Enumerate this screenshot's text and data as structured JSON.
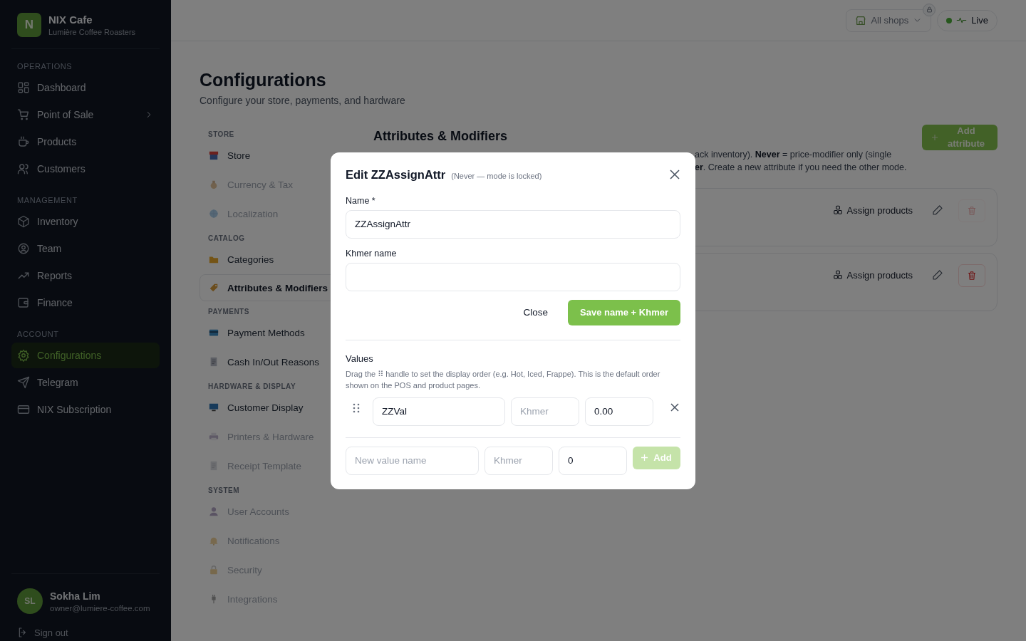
{
  "brand": {
    "initial": "N",
    "name": "NIX Cafe",
    "subtitle": "Lumière Coffee Roasters"
  },
  "sidebar": {
    "sections": [
      {
        "heading": "OPERATIONS",
        "items": [
          {
            "label": "Dashboard",
            "selected": false,
            "submenu": false
          },
          {
            "label": "Point of Sale",
            "selected": false,
            "submenu": true
          },
          {
            "label": "Products",
            "selected": false,
            "submenu": false
          },
          {
            "label": "Customers",
            "selected": false,
            "submenu": false
          }
        ]
      },
      {
        "heading": "MANAGEMENT",
        "items": [
          {
            "label": "Inventory",
            "selected": false,
            "submenu": false
          },
          {
            "label": "Team",
            "selected": false,
            "submenu": false
          },
          {
            "label": "Reports",
            "selected": false,
            "submenu": false
          },
          {
            "label": "Finance",
            "selected": false,
            "submenu": false
          }
        ]
      },
      {
        "heading": "ACCOUNT",
        "items": [
          {
            "label": "Configurations",
            "selected": true,
            "submenu": false
          },
          {
            "label": "Telegram",
            "selected": false,
            "submenu": false
          },
          {
            "label": "NIX Subscription",
            "selected": false,
            "submenu": false
          }
        ]
      }
    ]
  },
  "user": {
    "initials": "SL",
    "name": "Sokha Lim",
    "email": "owner@lumiere-coffee.com",
    "sign_out": "Sign out"
  },
  "topbar": {
    "shop_selector": {
      "label": "All shops",
      "locked": true
    },
    "live": {
      "label": "Live",
      "on": true
    }
  },
  "page": {
    "title": "Configurations",
    "subtitle": "Configure your store, payments, and hardware"
  },
  "settings_nav": [
    {
      "heading": "STORE",
      "items": [
        {
          "label": "Store",
          "selected": false,
          "disabled": false
        },
        {
          "label": "Currency & Tax",
          "selected": false,
          "disabled": true
        },
        {
          "label": "Localization",
          "selected": false,
          "disabled": true
        }
      ]
    },
    {
      "heading": "CATALOG",
      "items": [
        {
          "label": "Categories",
          "selected": false,
          "disabled": false
        },
        {
          "label": "Attributes & Modifiers",
          "selected": true,
          "disabled": false
        }
      ]
    },
    {
      "heading": "PAYMENTS",
      "items": [
        {
          "label": "Payment Methods",
          "selected": false,
          "disabled": false
        },
        {
          "label": "Cash In/Out Reasons",
          "selected": false,
          "disabled": false
        }
      ]
    },
    {
      "heading": "HARDWARE & DISPLAY",
      "items": [
        {
          "label": "Customer Display",
          "selected": false,
          "disabled": false
        },
        {
          "label": "Printers & Hardware",
          "selected": false,
          "disabled": true
        },
        {
          "label": "Receipt Template",
          "selected": false,
          "disabled": true
        }
      ]
    },
    {
      "heading": "SYSTEM",
      "items": [
        {
          "label": "User Accounts",
          "selected": false,
          "disabled": true
        },
        {
          "label": "Notifications",
          "selected": false,
          "disabled": true
        },
        {
          "label": "Security",
          "selected": false,
          "disabled": true
        },
        {
          "label": "Integrations",
          "selected": false,
          "disabled": true
        }
      ]
    }
  ],
  "panel": {
    "title": "Attributes & Modifiers",
    "add_button": "Add attribute",
    "description": [
      "ack inventory). **Never** = price-modifier only (single",
      "**er**. Create a new attribute if you need the other mode."
    ],
    "cards": [
      {
        "action": "Assign products",
        "delete_disabled": true
      },
      {
        "action": "Assign products",
        "delete_disabled": false
      }
    ]
  },
  "modal": {
    "title": "Edit ZZAssignAttr",
    "note": "(Never — mode is locked)",
    "name_field": {
      "label": "Name *",
      "value": "ZZAssignAttr"
    },
    "khmer_field": {
      "label": "Khmer name"
    },
    "close_button": "Close",
    "save_button": "Save name + Khmer",
    "values_heading": "Values",
    "values_help": "Drag the ⠿ handle to set the display order (e.g. Hot, Iced, Frappe). This is the default order shown on the POS and product pages.",
    "values": [
      {
        "name": "ZZVal",
        "khmer_placeholder": "Khmer",
        "price": "0.00"
      }
    ],
    "new_value": {
      "name_placeholder": "New value name",
      "khmer_placeholder": "Khmer",
      "price": "0",
      "add_label": "Add",
      "disabled": true
    }
  }
}
